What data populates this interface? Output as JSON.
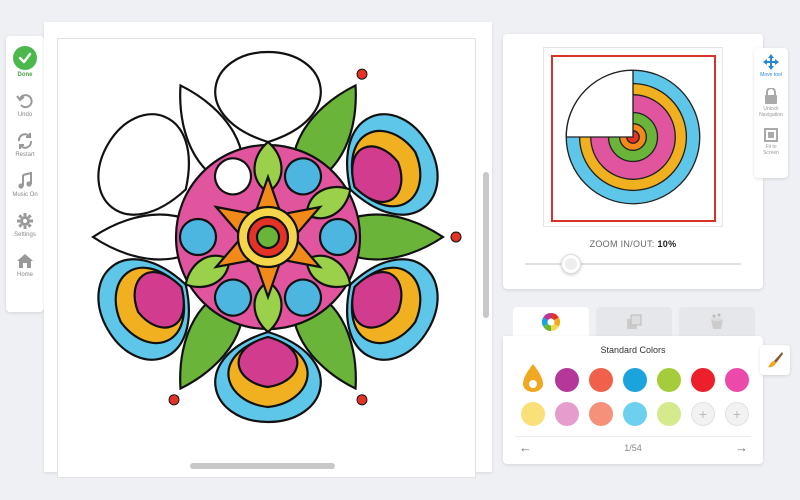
{
  "left_toolbar": {
    "done": "Done",
    "undo": "Undo",
    "restart": "Restart",
    "music": "Music On",
    "settings": "Settings",
    "home": "Home"
  },
  "right_toolbar": {
    "move_tool": "Move tool",
    "unlock_navigation_1": "Unlock",
    "unlock_navigation_2": "Navigation",
    "fit_to_screen_1": "Fit to",
    "fit_to_screen_2": "Screen"
  },
  "preview": {
    "zoom_label": "ZOOM IN/OUT:",
    "zoom_value": "10%",
    "zoom_level_fraction": 0.1
  },
  "color_panel": {
    "title": "Standard Colors",
    "page_indicator": "1/54",
    "row1": [
      "#f0a820",
      "#b5379a",
      "#f0604a",
      "#1aa3dc",
      "#a5cc3a",
      "#ec1f2a",
      "#ec4aa8"
    ],
    "row2": [
      "#fbe07a",
      "#e69ccc",
      "#f5907a",
      "#6cd0ee",
      "#d4ea8c"
    ],
    "add_slots": 2
  },
  "accent_colors": {
    "done_green": "#4ab84a",
    "active_blue": "#2a86d6",
    "preview_frame_red": "#d8332a"
  }
}
